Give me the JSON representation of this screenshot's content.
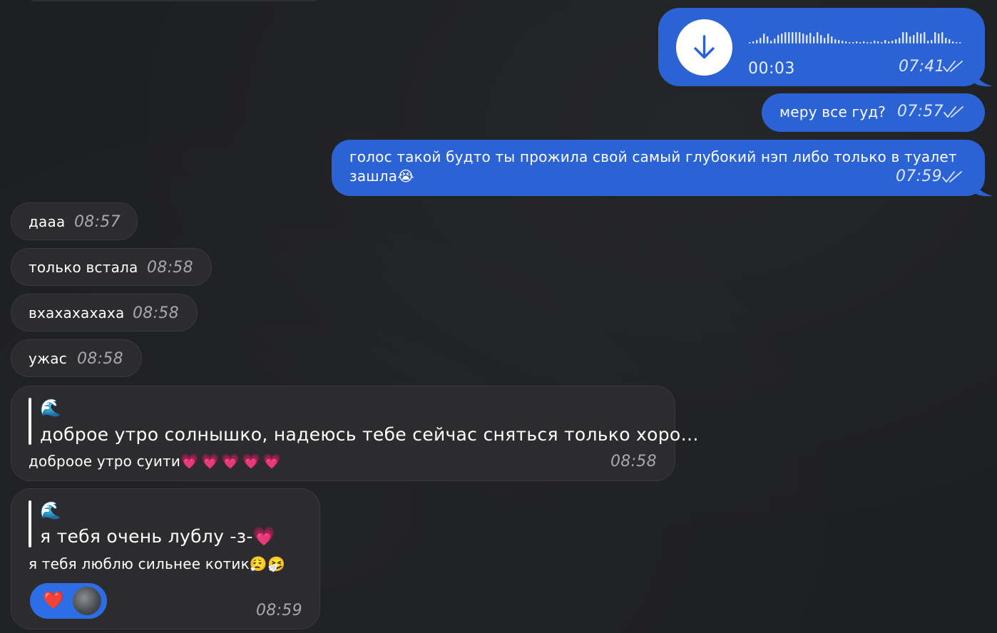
{
  "messages": {
    "voice": {
      "duration": "00:03",
      "time": "07:41",
      "icon": "download-arrow-icon"
    },
    "out_2": {
      "text": "меру все гуд?",
      "time": "07:57"
    },
    "out_3": {
      "line1": "голос такой будто ты прожила свой самый глубокий нэп либо только в туалет",
      "line2": "зашла",
      "emoji": "😭",
      "time": "07:59"
    },
    "in_1": {
      "text": "дааа",
      "time": "08:57"
    },
    "in_2": {
      "text": "только встала",
      "time": "08:58"
    },
    "in_3": {
      "text": "вхахахахаха",
      "time": "08:58"
    },
    "in_4": {
      "text": "ужас",
      "time": "08:58"
    },
    "in_5": {
      "quote_emoji": "🌊",
      "quote_text": "доброе утро солнышко, надеюсь тебе сейчас сняться только хоро…",
      "text": "доброое утро суити",
      "emojis": "💗💗💗💗💗",
      "time": "08:58"
    },
    "in_6": {
      "quote_emoji": "🌊",
      "quote_text": "я тебя очень лублу -з-",
      "quote_text_emoji": "💗",
      "text": "я тебя люблю сильнее котик",
      "emojis": "😮‍💨🤧",
      "reaction": "❤️",
      "time": "08:59"
    }
  },
  "colors": {
    "background": "#1e1f21",
    "outgoing_bubble": "#2b63d4",
    "incoming_bubble": "#2c2c2e",
    "reaction_pill": "#2d6ee6"
  }
}
